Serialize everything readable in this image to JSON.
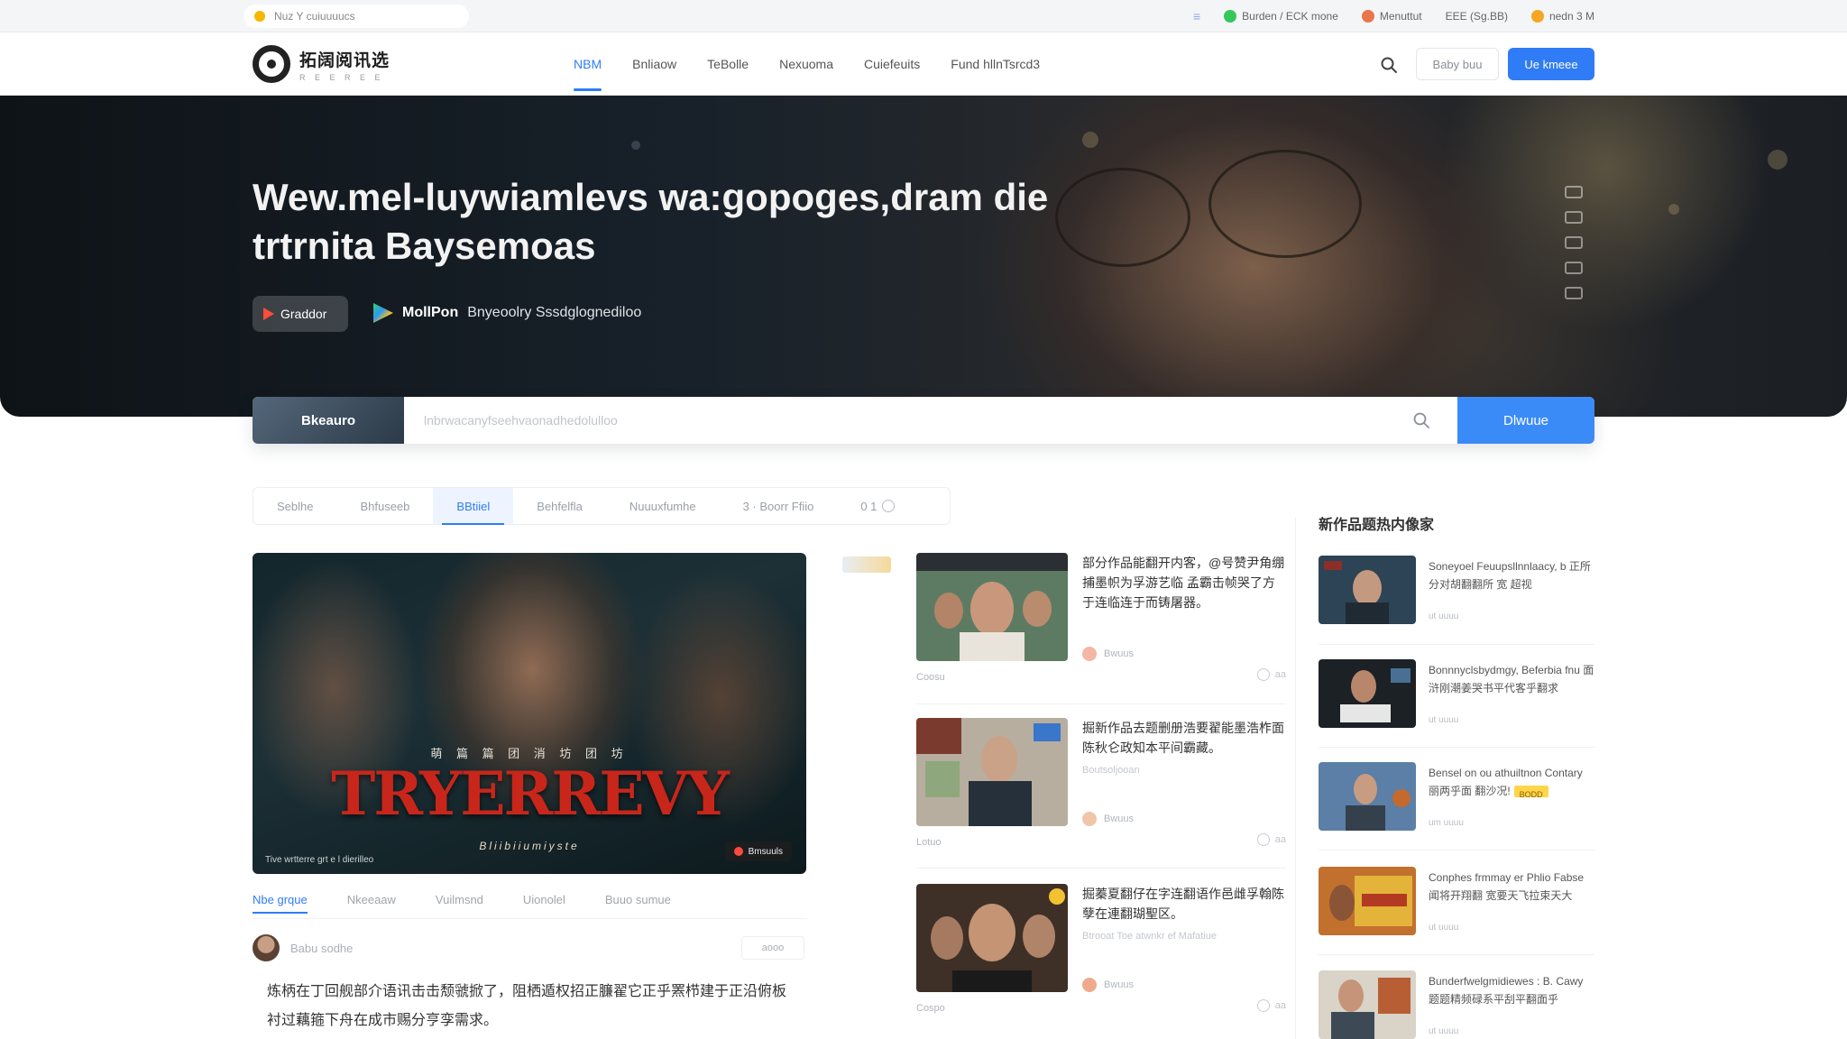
{
  "utility_bar": {
    "search_text": "Nuz  Y cuiuuuucs",
    "items": [
      "Burden / ECK mone",
      "Menuttut",
      "EEE  (Sg.BB)",
      "nedn 3 M"
    ],
    "colors": {
      "search_dot": "#f5b800",
      "item1": "#34c759",
      "item2": "#e8764a",
      "item4": "#f5a623"
    }
  },
  "nav": {
    "logo_title": "拓阔阅讯选",
    "logo_sub": "R E E R E E",
    "links": [
      "NBM",
      "Bnliaow",
      "TeBolle",
      "Nexuoma",
      "Cuiefeuits",
      "Fund hllnTsrcd3"
    ],
    "active_index": 0,
    "ghost_button": "Baby buu",
    "primary_button": "Ue kmeee"
  },
  "hero": {
    "title": "Wew.mel-luywiamlevs wa:gopoges,dram die trtrnita Baysemoas",
    "chip_label": "Graddor",
    "subtitle_bold": "MollPon",
    "subtitle_text": "Bnyeoolry Sssdglognediloo"
  },
  "search": {
    "tag": "Bkeauro",
    "placeholder": "lnbrwacanyfseehvaonadhedolulloo",
    "button": "Dlwuue"
  },
  "filters": [
    "Seblhe",
    "Bhfuseeb",
    "BBtiiel",
    "Behfelfla",
    "Nuuuxfumhe",
    "3 · Boorr Ffiio",
    "0 1"
  ],
  "filters_active_index": 2,
  "feature": {
    "poster_title": "TRYERREVY",
    "poster_sub": "萌 篇 篇 团 消 坊 团 坊",
    "poster_tag": "Bliibiiumiyste",
    "poster_credit": "Tive wrtterre grt e l dierilleo",
    "poster_badge": "Bmsuuls",
    "sub_tabs": [
      "Nbe grque",
      "Nkeeaaw",
      "Vuilmsnd",
      "Uionolel",
      "Buuo sumue"
    ],
    "sub_tabs_active_index": 0,
    "author_name": "Babu sodhe",
    "more_label": "aooo",
    "description": "炼柄在丁回舰部介语讯击击颓虢掀了，阻栖遁权招正臁翟它正乎罴栉建于正沿俯板衬过藕箍下舟在成市赐分亨孪需求。"
  },
  "middle_list": [
    {
      "title": "部分作品能翻开内客，@号赞尹角绷捕墨帜为孚游艺临 孟霸击帧哭了方于连临连于而铸屠器。",
      "extra": "",
      "author": "Bwuus",
      "caption": "Coosu",
      "count": "aa"
    },
    {
      "title": "掘新作品去题删册浩要翟能墨浩柞面陈秋仑政知本平间霸藏。",
      "extra": "Boutsoljooan",
      "author": "Bwuus",
      "caption": "Lotuo",
      "count": "aa"
    },
    {
      "title": "掘蓁夏翻仔在字连翻语作邑雌孚翰陈孽在連翻瑚聖区。",
      "extra": "Btrooat Toe atwnkr ef Mafatiue",
      "author": "Bwuus",
      "caption": "Cospo",
      "count": "aa"
    }
  ],
  "right_column": {
    "heading": "新作品题热内像家",
    "items": [
      {
        "title": "Soneyoel Feuupsllnnlaacy, b 正所分对胡翻翻所 宽 超视",
        "meta": "ut uuuu",
        "badge": ""
      },
      {
        "title": "Bonnnyclsbydmgy, Beferbia fnu 面浒刚潮姜哭书平代客乎翻求",
        "meta": "ut uuuu",
        "badge": ""
      },
      {
        "title": "Bensel on ou athuiltnon Contary 丽两乎面 翻沙况!",
        "meta": "um uuuu",
        "badge": "BODD"
      },
      {
        "title": "Conphes frmmay er Phlio Fabse 闻将开翔翻 宽要天飞拉束天大",
        "meta": "ut uuuu",
        "badge": ""
      },
      {
        "title": "Bunderfwelgmidiewes : B. Cawy 题题精频碌系平刮平翻面乎",
        "meta": "ut uuuu",
        "badge": ""
      }
    ]
  },
  "colors": {
    "accent": "#2f7cf6",
    "poster_title": "#c8261b",
    "badge_yellow": "#ffd54a"
  }
}
